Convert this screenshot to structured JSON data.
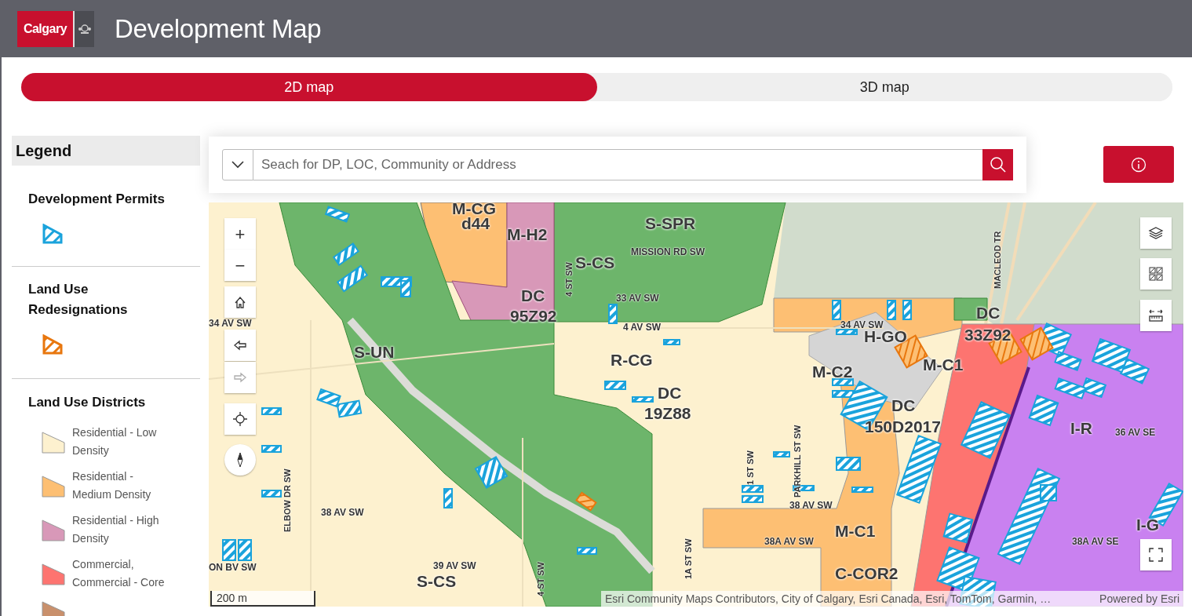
{
  "header": {
    "logo_text": "Calgary",
    "title": "Development Map"
  },
  "view_tabs": [
    {
      "label": "2D map",
      "selected": true
    },
    {
      "label": "3D map",
      "selected": false
    }
  ],
  "legend": {
    "title": "Legend",
    "sections": [
      {
        "title": "Development Permits",
        "kind": "single",
        "color": "#1aa3dc"
      },
      {
        "title": "Land Use Redesignations",
        "kind": "single",
        "color": "#e8770e"
      },
      {
        "title": "Land Use Districts",
        "kind": "list",
        "items": [
          {
            "label": "Residential - Low Density",
            "color": "#fdf1cf"
          },
          {
            "label": "Residential - Medium Density",
            "color": "#fdbf73"
          },
          {
            "label": "Residential - High Density",
            "color": "#d898b8"
          },
          {
            "label": "Commercial, Commercial - Core",
            "color": "#fd7470"
          },
          {
            "color": "#c9906c"
          }
        ]
      }
    ]
  },
  "search": {
    "placeholder": "Seach for DP, LOC, Community or Address"
  },
  "map": {
    "labels": [
      {
        "text": "M-CG",
        "kind": "zone"
      },
      {
        "text": "d44",
        "kind": "zone"
      },
      {
        "text": "M-H2",
        "kind": "zone"
      },
      {
        "text": "S-SPR",
        "kind": "zone"
      },
      {
        "text": "S-CS",
        "kind": "zone"
      },
      {
        "text": "DC",
        "kind": "zone"
      },
      {
        "text": "95Z92",
        "kind": "zone"
      },
      {
        "text": "S-UN",
        "kind": "zone"
      },
      {
        "text": "R-CG",
        "kind": "zone"
      },
      {
        "text": "DC",
        "kind": "zone"
      },
      {
        "text": "19Z88",
        "kind": "zone"
      },
      {
        "text": "H-GO",
        "kind": "zone"
      },
      {
        "text": "M-C2",
        "kind": "zone"
      },
      {
        "text": "M-C1",
        "kind": "zone"
      },
      {
        "text": "DC",
        "kind": "zone"
      },
      {
        "text": "33Z92",
        "kind": "zone"
      },
      {
        "text": "DC",
        "kind": "zone"
      },
      {
        "text": "150D2017",
        "kind": "zone"
      },
      {
        "text": "I-R",
        "kind": "zone"
      },
      {
        "text": "I-G",
        "kind": "zone"
      },
      {
        "text": "M-C1",
        "kind": "zone"
      },
      {
        "text": "C-COR2",
        "kind": "zone"
      },
      {
        "text": "S-CS",
        "kind": "zone"
      },
      {
        "text": "MISSION RD SW",
        "kind": "street"
      },
      {
        "text": "33 AV SW",
        "kind": "street"
      },
      {
        "text": "34 AV SW",
        "kind": "street"
      },
      {
        "text": "4 AV SW",
        "kind": "street"
      },
      {
        "text": "34 AV SW",
        "kind": "street"
      },
      {
        "text": "38 AV SW",
        "kind": "street"
      },
      {
        "text": "38 AV SW",
        "kind": "street"
      },
      {
        "text": "38A AV SW",
        "kind": "street"
      },
      {
        "text": "39 AV SW",
        "kind": "street"
      },
      {
        "text": "36 AV SE",
        "kind": "street"
      },
      {
        "text": "38A AV SE",
        "kind": "street"
      },
      {
        "text": "ON BV SW",
        "kind": "street"
      },
      {
        "text": "ELBOW DR SW",
        "kind": "vstreet"
      },
      {
        "text": "1 ST SW",
        "kind": "vstreet"
      },
      {
        "text": "PARKHILL ST SW",
        "kind": "vstreet"
      },
      {
        "text": "4 ST SW",
        "kind": "vstreet"
      },
      {
        "text": "1A ST SW",
        "kind": "vstreet"
      },
      {
        "text": "4 ST SW",
        "kind": "vstreet"
      },
      {
        "text": "MACLEOD TR",
        "kind": "vstreet"
      }
    ],
    "controls": [
      {
        "kind": "zoom-in",
        "text": "+"
      },
      {
        "kind": "zoom-out",
        "text": "−"
      },
      {
        "kind": "home"
      },
      {
        "kind": "back",
        "disabled": false
      },
      {
        "kind": "forward",
        "disabled": true
      },
      {
        "kind": "locate"
      },
      {
        "kind": "compass"
      }
    ],
    "tools": [
      {
        "kind": "layers"
      },
      {
        "kind": "basemap"
      },
      {
        "kind": "measure"
      },
      {
        "kind": "fullscreen"
      }
    ],
    "scale": "200 m",
    "attribution": "Esri Community Maps Contributors, City of Calgary, Esri Canada, Esri, TomTom, Garmin, …",
    "powered_by": "Powered by Esri"
  }
}
